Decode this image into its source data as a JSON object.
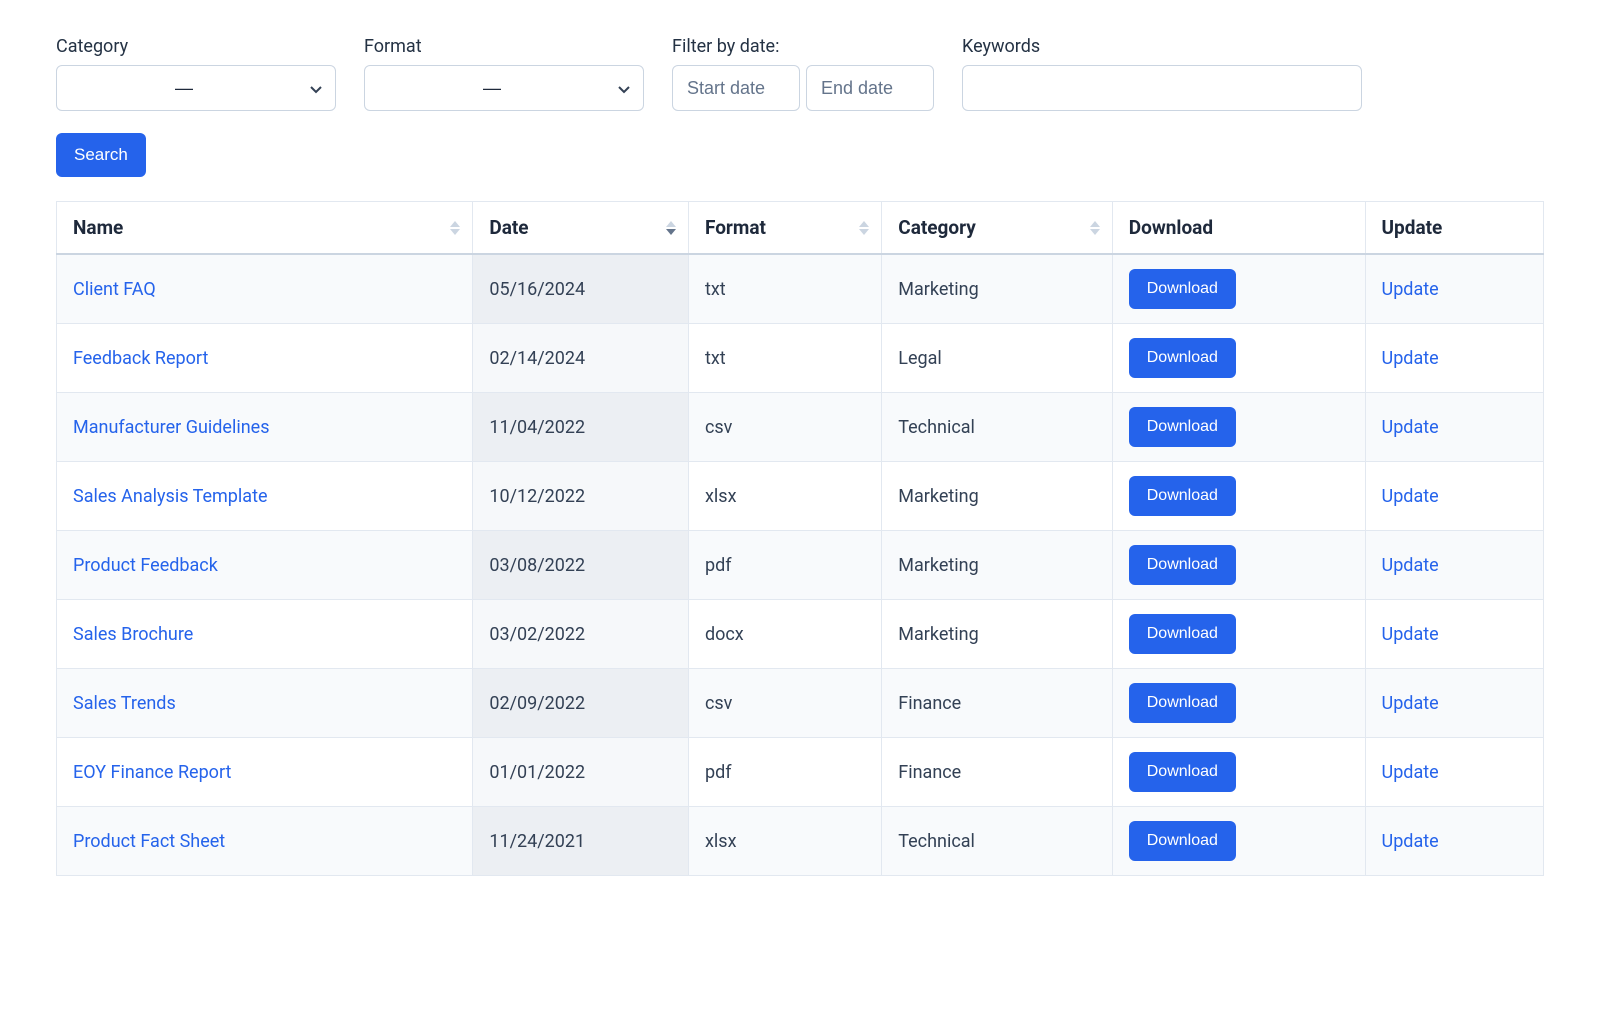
{
  "filters": {
    "category": {
      "label": "Category",
      "value": "—"
    },
    "format": {
      "label": "Format",
      "value": "—"
    },
    "date": {
      "label": "Filter by date:",
      "start_placeholder": "Start date",
      "end_placeholder": "End date"
    },
    "keywords": {
      "label": "Keywords",
      "value": ""
    }
  },
  "actions": {
    "search": "Search",
    "download": "Download",
    "update": "Update"
  },
  "table": {
    "headers": {
      "name": "Name",
      "date": "Date",
      "format": "Format",
      "category": "Category",
      "download": "Download",
      "update": "Update"
    },
    "sort": {
      "column": "date",
      "direction": "desc"
    },
    "rows": [
      {
        "name": "Client FAQ",
        "date": "05/16/2024",
        "format": "txt",
        "category": "Marketing"
      },
      {
        "name": "Feedback Report",
        "date": "02/14/2024",
        "format": "txt",
        "category": "Legal"
      },
      {
        "name": "Manufacturer Guidelines",
        "date": "11/04/2022",
        "format": "csv",
        "category": "Technical"
      },
      {
        "name": "Sales Analysis Template",
        "date": "10/12/2022",
        "format": "xlsx",
        "category": "Marketing"
      },
      {
        "name": "Product Feedback",
        "date": "03/08/2022",
        "format": "pdf",
        "category": "Marketing"
      },
      {
        "name": "Sales Brochure",
        "date": "03/02/2022",
        "format": "docx",
        "category": "Marketing"
      },
      {
        "name": "Sales Trends",
        "date": "02/09/2022",
        "format": "csv",
        "category": "Finance"
      },
      {
        "name": "EOY Finance Report",
        "date": "01/01/2022",
        "format": "pdf",
        "category": "Finance"
      },
      {
        "name": "Product Fact Sheet",
        "date": "11/24/2021",
        "format": "xlsx",
        "category": "Technical"
      }
    ]
  }
}
